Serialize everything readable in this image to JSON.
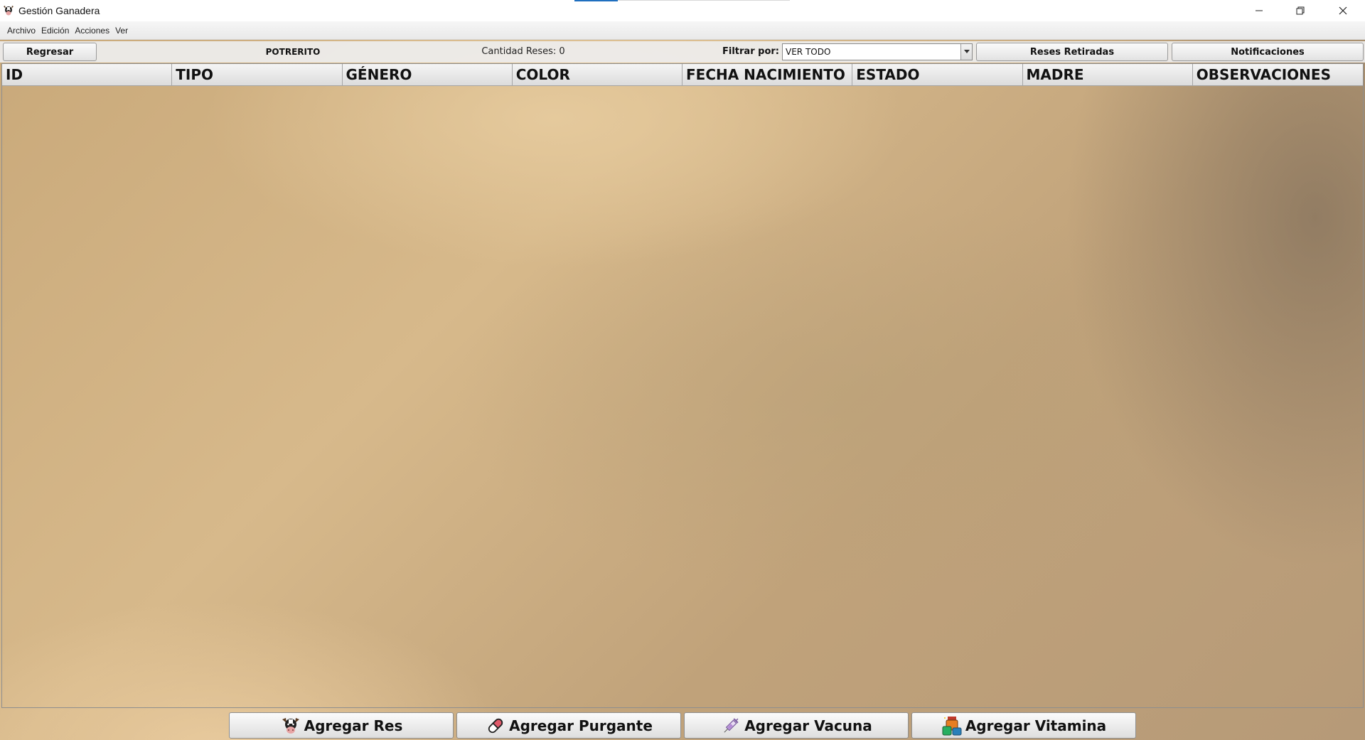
{
  "window": {
    "title": "Gestión Ganadera",
    "icon": "cow-head-icon"
  },
  "menu": {
    "items": [
      "Archivo",
      "Edición",
      "Acciones",
      "Ver"
    ]
  },
  "toolbar": {
    "back_label": "Regresar",
    "paddock_name": "POTRERITO",
    "count_text": "Cantidad Reses: 0",
    "filter_label": "Filtrar por:",
    "filter_value": "VER TODO",
    "retired_label": "Reses Retiradas",
    "notifications_label": "Notificaciones"
  },
  "table": {
    "columns": [
      "ID",
      "TIPO",
      "GÉNERO",
      "COLOR",
      "FECHA NACIMIENTO",
      "ESTADO",
      "MADRE",
      "OBSERVACIONES"
    ],
    "rows": []
  },
  "actions": {
    "add_res": {
      "label": "Agregar Res",
      "icon": "cow-head-icon"
    },
    "add_purgante": {
      "label": "Agregar Purgante",
      "icon": "pill-icon"
    },
    "add_vacuna": {
      "label": "Agregar Vacuna",
      "icon": "syringe-icon"
    },
    "add_vitamina": {
      "label": "Agregar Vitamina",
      "icon": "vitamin-bottles-icon"
    }
  },
  "colors": {
    "background_tone": "#c9a97a",
    "focus_accent": "#1f6fbf"
  }
}
